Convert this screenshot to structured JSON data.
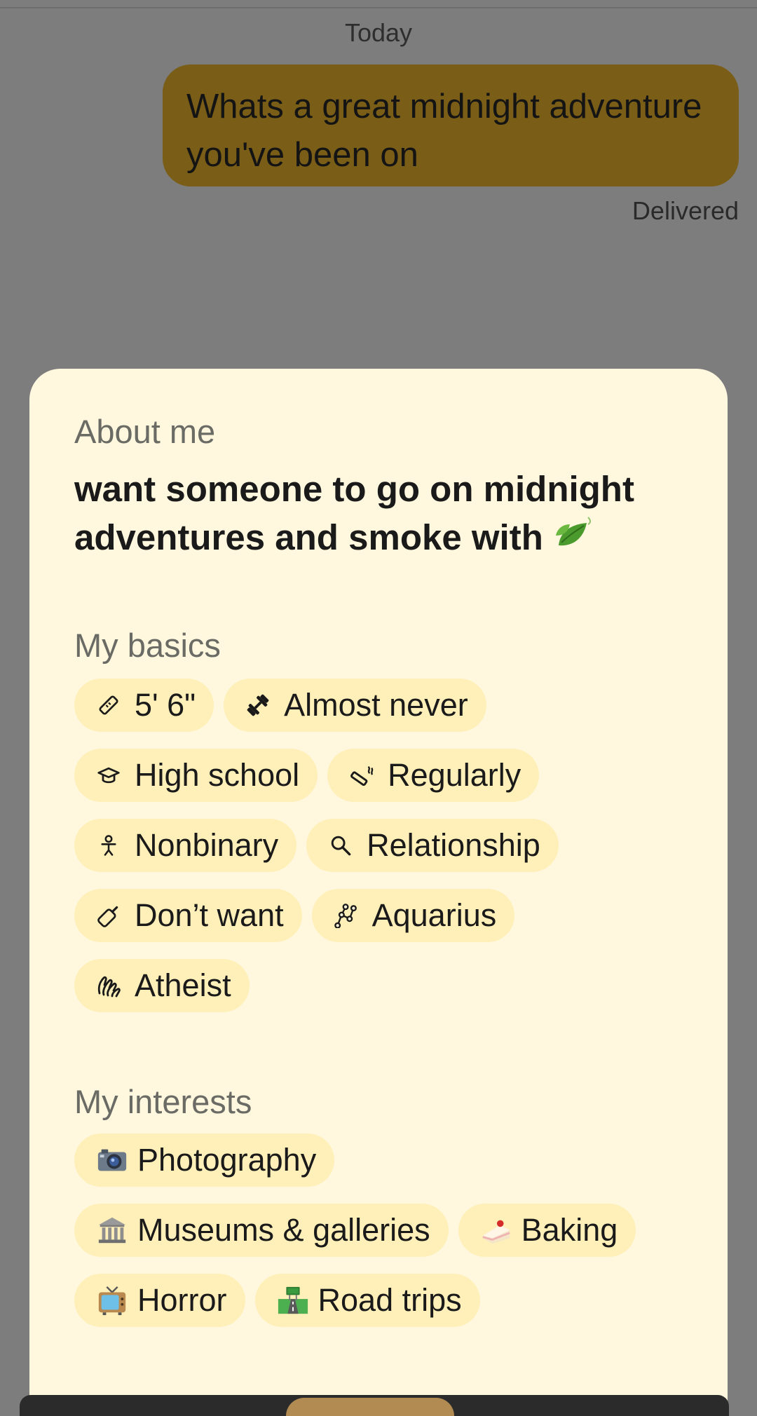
{
  "chat": {
    "date_label": "Today",
    "message": "Whats a great midnight adventure you've been on",
    "status": "Delivered",
    "bubble_color": "#7a5d16"
  },
  "profile_card": {
    "about_title": "About me",
    "about_text": "want someone to go on midnight adventures and smoke with",
    "about_emoji": "leaf-icon",
    "basics_title": "My basics",
    "basics": [
      {
        "icon": "ruler-icon",
        "label": "5' 6\""
      },
      {
        "icon": "dumbbell-icon",
        "label": "Almost never"
      },
      {
        "icon": "graduation-cap-icon",
        "label": "High school"
      },
      {
        "icon": "smoking-icon",
        "label": "Regularly"
      },
      {
        "icon": "person-icon",
        "label": "Nonbinary"
      },
      {
        "icon": "magnifier-icon",
        "label": "Relationship"
      },
      {
        "icon": "baby-bottle-icon",
        "label": "Don’t want"
      },
      {
        "icon": "constellation-icon",
        "label": "Aquarius"
      },
      {
        "icon": "praying-hands-icon",
        "label": "Atheist"
      }
    ],
    "interests_title": "My interests",
    "interests": [
      {
        "icon": "camera-icon",
        "label": "Photography"
      },
      {
        "icon": "museum-icon",
        "label": "Museums & galleries"
      },
      {
        "icon": "cake-icon",
        "label": "Baking"
      },
      {
        "icon": "television-icon",
        "label": "Horror"
      },
      {
        "icon": "road-icon",
        "label": "Road trips"
      }
    ],
    "chip_color": "#ffefb8",
    "card_color": "#fff8de"
  }
}
